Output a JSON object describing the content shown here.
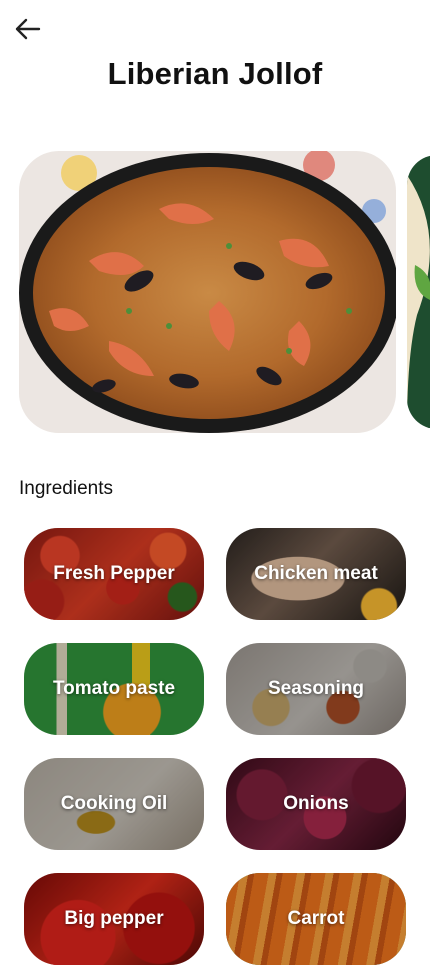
{
  "header": {
    "back_icon": "arrow-left-icon",
    "title": "Liberian Jollof"
  },
  "carousel": {
    "items": [
      {
        "name": "hero-dish-image"
      },
      {
        "name": "next-dish-image"
      }
    ]
  },
  "ingredients": {
    "label": "Ingredients",
    "items": [
      {
        "label": "Fresh Pepper"
      },
      {
        "label": "Chicken meat"
      },
      {
        "label": "Tomato paste"
      },
      {
        "label": "Seasoning"
      },
      {
        "label": "Cooking Oil"
      },
      {
        "label": "Onions"
      },
      {
        "label": "Big pepper"
      },
      {
        "label": "Carrot"
      }
    ]
  },
  "colors": {
    "background": "#ffffff",
    "text": "#111111",
    "chip_text": "#ffffff"
  }
}
